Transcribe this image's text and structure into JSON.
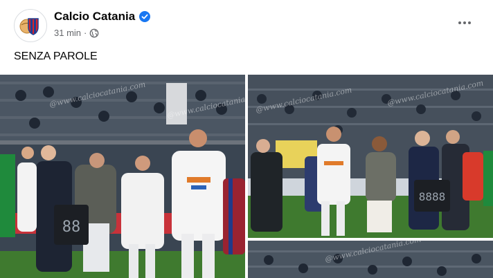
{
  "post": {
    "page_name": "Calcio Catania",
    "time": "31 min",
    "text": "SENZA PAROLE",
    "verified_color": "#1877f2",
    "privacy_icon": "globe-icon",
    "more_icon": "more-horiz-icon"
  },
  "photos": {
    "watermark": "@www.calciocatania.com",
    "board1_digits": "88",
    "board2_digits": "8888"
  },
  "colors": {
    "team_orange": "#e07a2a",
    "team_blue": "#2b63b8",
    "pitch": "#3f7a2f",
    "opponent_green": "#1f8a3c"
  }
}
